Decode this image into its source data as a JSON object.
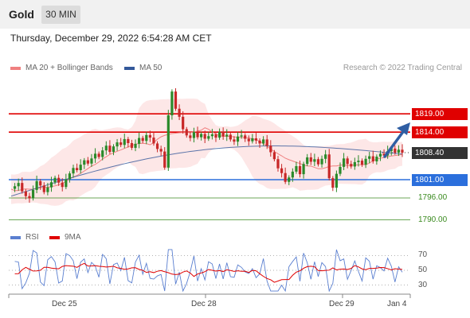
{
  "header": {
    "instrument": "Gold",
    "timeframe": "30 MIN",
    "datetime": "Thursday, December 29, 2022 6:54:28 AM CET"
  },
  "legend": {
    "ma20": "MA 20 + Bollinger Bands",
    "ma50": "MA 50",
    "credit": "Research © 2022 Trading Central",
    "rsi": "RSI",
    "rsi_ma": "9MA"
  },
  "colors": {
    "resistance": "#e00000",
    "support": "#2b6fdc",
    "target": "#3a8a1f",
    "ma20": "#f08080",
    "ma50": "#33589a",
    "band_fill": "#fde3e3",
    "candle_up": "#2a8a2a",
    "candle_down": "#c82828",
    "arrow": "#2f5ea3",
    "last_price_bg": "#333333"
  },
  "chart_data": {
    "type": "candlestick",
    "x_ticks": [
      "Dec 25",
      "Dec 28",
      "Dec 29",
      "Jan 4"
    ],
    "price_levels": [
      {
        "label": "1819.00",
        "value": 1819.0,
        "kind": "resistance"
      },
      {
        "label": "1814.00",
        "value": 1814.0,
        "kind": "resistance"
      },
      {
        "label": "1808.40",
        "value": 1808.4,
        "kind": "last"
      },
      {
        "label": "1801.00",
        "value": 1801.0,
        "kind": "pivot"
      },
      {
        "label": "1796.00",
        "value": 1796.0,
        "kind": "target"
      },
      {
        "label": "1790.00",
        "value": 1790.0,
        "kind": "target"
      }
    ],
    "rsi_levels": [
      "70",
      "50",
      "30"
    ],
    "close_series": [
      1798.5,
      1799.2,
      1800.1,
      1797.8,
      1796.5,
      1795.9,
      1798.2,
      1800.6,
      1799.4,
      1797.6,
      1798.9,
      1800.3,
      1801.5,
      1800.2,
      1799.0,
      1801.1,
      1802.7,
      1804.2,
      1803.6,
      1805.1,
      1806.3,
      1805.4,
      1806.8,
      1808.1,
      1807.2,
      1809.0,
      1810.3,
      1808.6,
      1810.1,
      1811.2,
      1810.5,
      1812.1,
      1811.0,
      1809.7,
      1810.8,
      1812.4,
      1811.6,
      1813.2,
      1812.5,
      1810.9,
      1809.4,
      1808.7,
      1804.3,
      1818.6,
      1825.1,
      1820.4,
      1818.2,
      1814.8,
      1813.1,
      1812.4,
      1814.0,
      1812.6,
      1813.5,
      1812.2,
      1812.9,
      1813.4,
      1812.5,
      1814.1,
      1812.8,
      1813.3,
      1812.0,
      1811.4,
      1812.8,
      1813.1,
      1812.2,
      1811.5,
      1812.3,
      1811.7,
      1810.9,
      1812.0,
      1810.3,
      1808.5,
      1806.6,
      1804.1,
      1802.8,
      1800.4,
      1801.6,
      1803.2,
      1804.7,
      1802.5,
      1805.3,
      1807.1,
      1805.9,
      1806.6,
      1805.2,
      1806.7,
      1807.9,
      1801.4,
      1798.8,
      1802.6,
      1804.5,
      1806.8,
      1805.3,
      1804.6,
      1805.8,
      1806.2,
      1805.1,
      1806.7,
      1807.4,
      1806.0,
      1807.3,
      1808.1,
      1807.6,
      1808.8,
      1809.5,
      1808.4,
      1809.2,
      1808.4
    ],
    "ma20_start": 1799.0,
    "ma20_end": 1808.0,
    "ma50_start": 1796.5,
    "ma50_end": 1808.0
  }
}
